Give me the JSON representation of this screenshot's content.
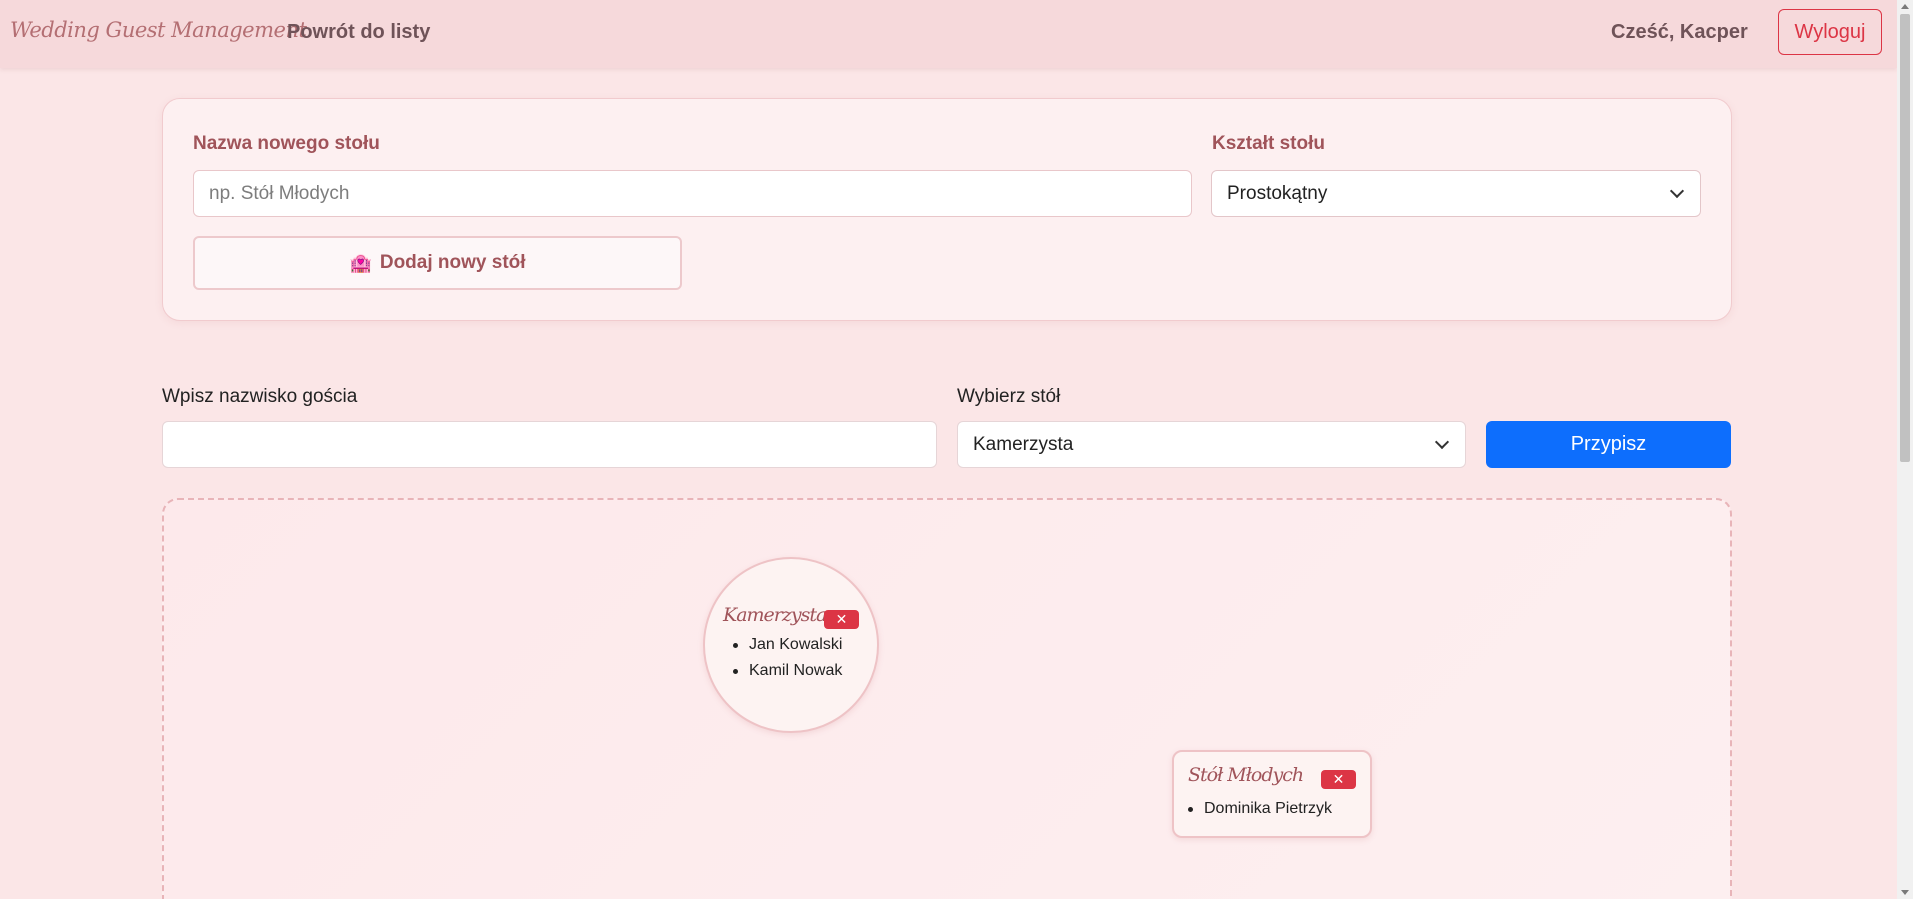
{
  "navbar": {
    "brand": "Wedding Guest Management",
    "back_link": "Powrót do listy",
    "greeting": "Cześć, Kacper",
    "logout": "Wyloguj"
  },
  "add_table": {
    "name_label": "Nazwa nowego stołu",
    "name_placeholder": "np. Stół Młodych",
    "name_value": "",
    "shape_label": "Kształt stołu",
    "shape_selected": "Prostokątny",
    "add_button_icon": "🏩",
    "add_button": "Dodaj nowy stół"
  },
  "assign": {
    "guest_label": "Wpisz nazwisko gościa",
    "guest_value": "",
    "table_label": "Wybierz stół",
    "table_selected": "Kamerzysta",
    "assign_button": "Przypisz"
  },
  "tables": [
    {
      "name": "Kamerzysta",
      "shape": "round",
      "delete_label": "✕",
      "guests": [
        "Jan Kowalski",
        "Kamil Nowak"
      ]
    },
    {
      "name": "Stół Młodych",
      "shape": "rectangle",
      "delete_label": "✕",
      "guests": [
        "Dominika Pietrzyk"
      ]
    }
  ],
  "colors": {
    "accent": "#a0545a",
    "primary": "#0d6efd",
    "danger": "#dc3545",
    "background": "#fbe6e7"
  }
}
